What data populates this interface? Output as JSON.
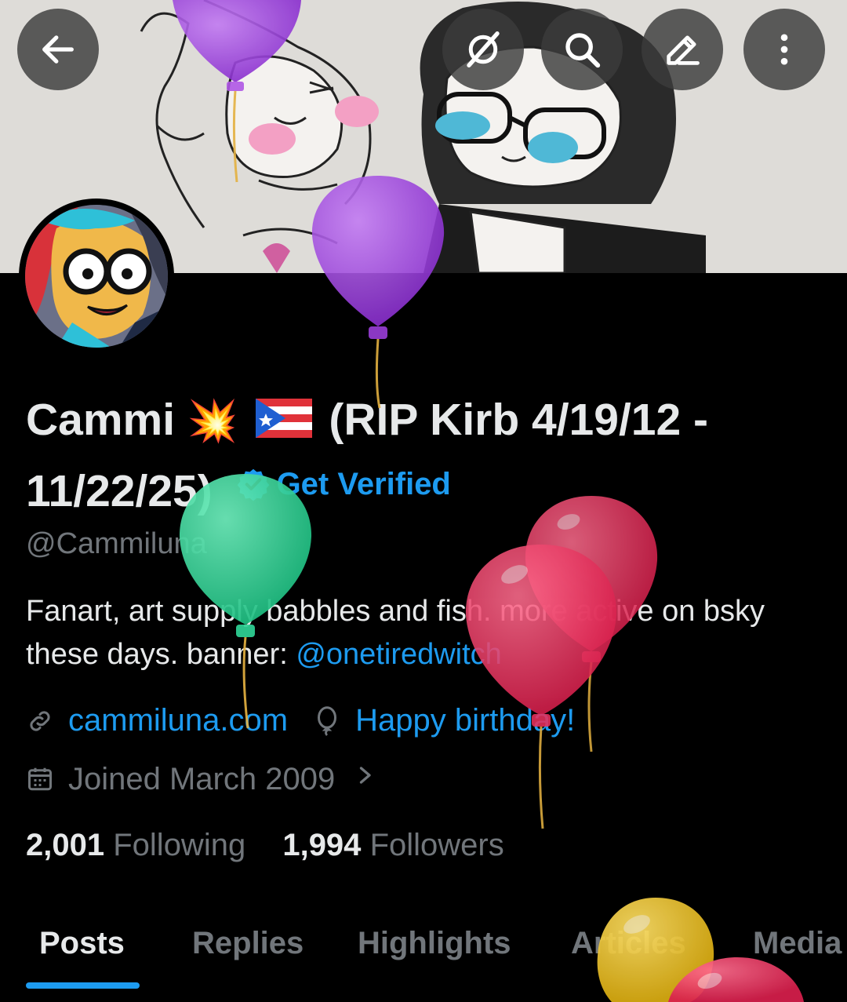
{
  "header": {
    "back_icon": "arrow-left-icon",
    "grok_icon": "grok-icon",
    "search_icon": "search-icon",
    "edit_icon": "pencil-icon",
    "more_icon": "more-vertical-icon"
  },
  "profile": {
    "name_part1": "Cammi",
    "name_emoji": "💥",
    "name_part2": "(RIP Kirb 4/19/12 - 11/22/25)",
    "get_verified": "Get Verified",
    "handle": "@Cammiluna",
    "bio_text": "Fanart, art supply babbles and fish.  more active on bsky these days.  banner: ",
    "bio_mention": "@onetiredwitch",
    "website": "cammiluna.com",
    "birthday_text": "Happy birthday!",
    "joined": "Joined March 2009",
    "following_count": "2,001",
    "following_label": "Following",
    "followers_count": "1,994",
    "followers_label": "Followers"
  },
  "tabs": [
    "Posts",
    "Replies",
    "Highlights",
    "Articles",
    "Media"
  ],
  "colors": {
    "accent": "#1d9bf0",
    "balloon_purple": "#9b3fd9",
    "balloon_green": "#2fd396",
    "balloon_red": "#e8305c",
    "balloon_yellow": "#e9c326"
  }
}
